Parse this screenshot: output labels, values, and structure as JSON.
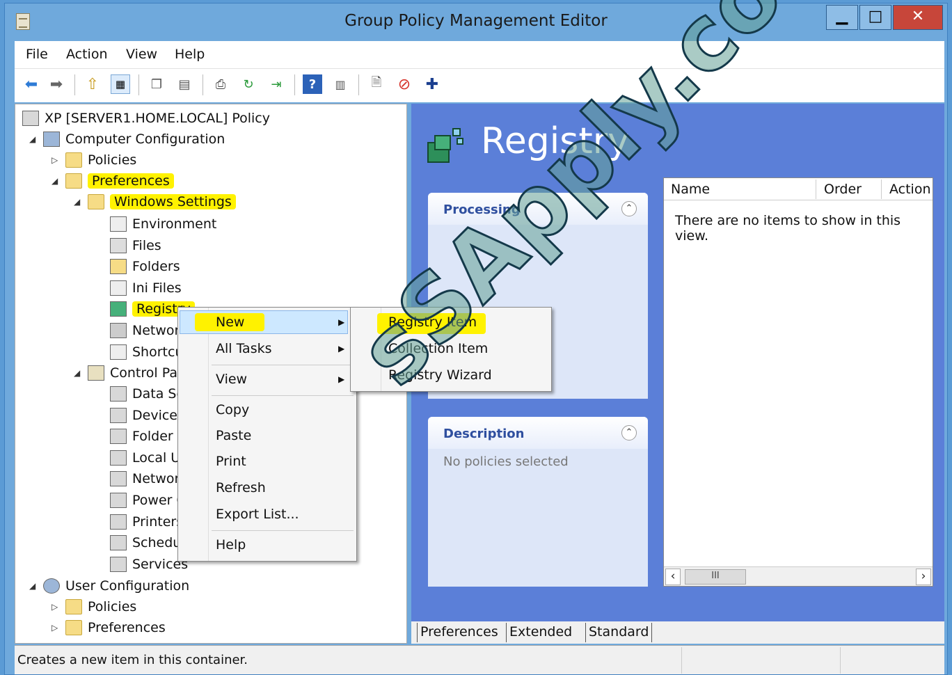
{
  "window": {
    "title": "Group Policy Management Editor"
  },
  "menubar": [
    "File",
    "Action",
    "View",
    "Help"
  ],
  "tree": {
    "root": "XP [SERVER1.HOME.LOCAL] Policy",
    "computer_config": "Computer Configuration",
    "policies": "Policies",
    "preferences": "Preferences",
    "windows_settings": "Windows Settings",
    "ws_items": [
      "Environment",
      "Files",
      "Folders",
      "Ini Files",
      "Registry",
      "Network Shares",
      "Shortcuts"
    ],
    "control_panel": "Control Panel Settings",
    "cp_items": [
      "Data Sources",
      "Devices",
      "Folder Options",
      "Local Users and Groups",
      "Network Options",
      "Power Options",
      "Printers",
      "Scheduled Tasks",
      "Services"
    ],
    "user_config": "User Configuration",
    "user_policies": "Policies",
    "user_preferences": "Preferences"
  },
  "context_menu": {
    "items": [
      "New",
      "All Tasks",
      "View",
      "Copy",
      "Paste",
      "Print",
      "Refresh",
      "Export List...",
      "Help"
    ]
  },
  "submenu": {
    "items": [
      "Registry Item",
      "Collection Item",
      "Registry Wizard"
    ]
  },
  "right": {
    "heading": "Registry",
    "processing": "Processing",
    "description": "Description",
    "no_policies": "No policies selected",
    "columns": [
      "Name",
      "Order",
      "Action"
    ],
    "empty": "There are no items to show in this view.",
    "scroll_thumb": "III"
  },
  "tabs": [
    "Preferences",
    "Extended",
    "Standard"
  ],
  "status": "Creates a new item in this container.",
  "watermark": "sSApply.com",
  "colors": {
    "title_bar": "#6fa9dc",
    "pane": "#5b7fd8",
    "highlight": "#fff200",
    "close": "#c7463a"
  }
}
